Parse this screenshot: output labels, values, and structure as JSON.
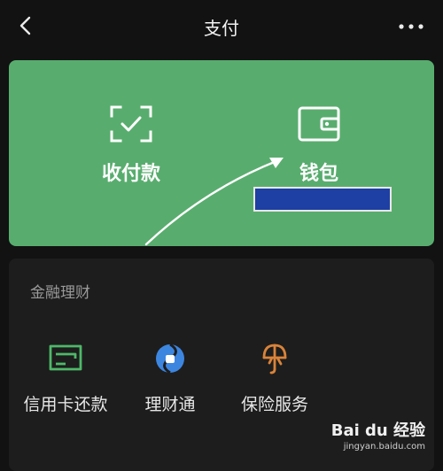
{
  "header": {
    "title": "支付",
    "back_icon": "chevron-left-icon",
    "more_icon": "more-horizontal-icon"
  },
  "card": {
    "bg_color": "#58ad6e",
    "pay": {
      "label": "收付款",
      "icon": "scan-check-icon"
    },
    "wallet": {
      "label": "钱包",
      "icon": "wallet-icon"
    }
  },
  "finance": {
    "title": "金融理财",
    "items": [
      {
        "label": "信用卡还款",
        "icon": "credit-card-icon",
        "color": "#4fb869"
      },
      {
        "label": "理财通",
        "icon": "licaitong-icon",
        "color": "#3d86e0"
      },
      {
        "label": "保险服务",
        "icon": "insurance-icon",
        "color": "#d9833a"
      }
    ]
  },
  "watermark": {
    "brand": "Bai du 经验",
    "url": "jingyan.baidu.com"
  }
}
